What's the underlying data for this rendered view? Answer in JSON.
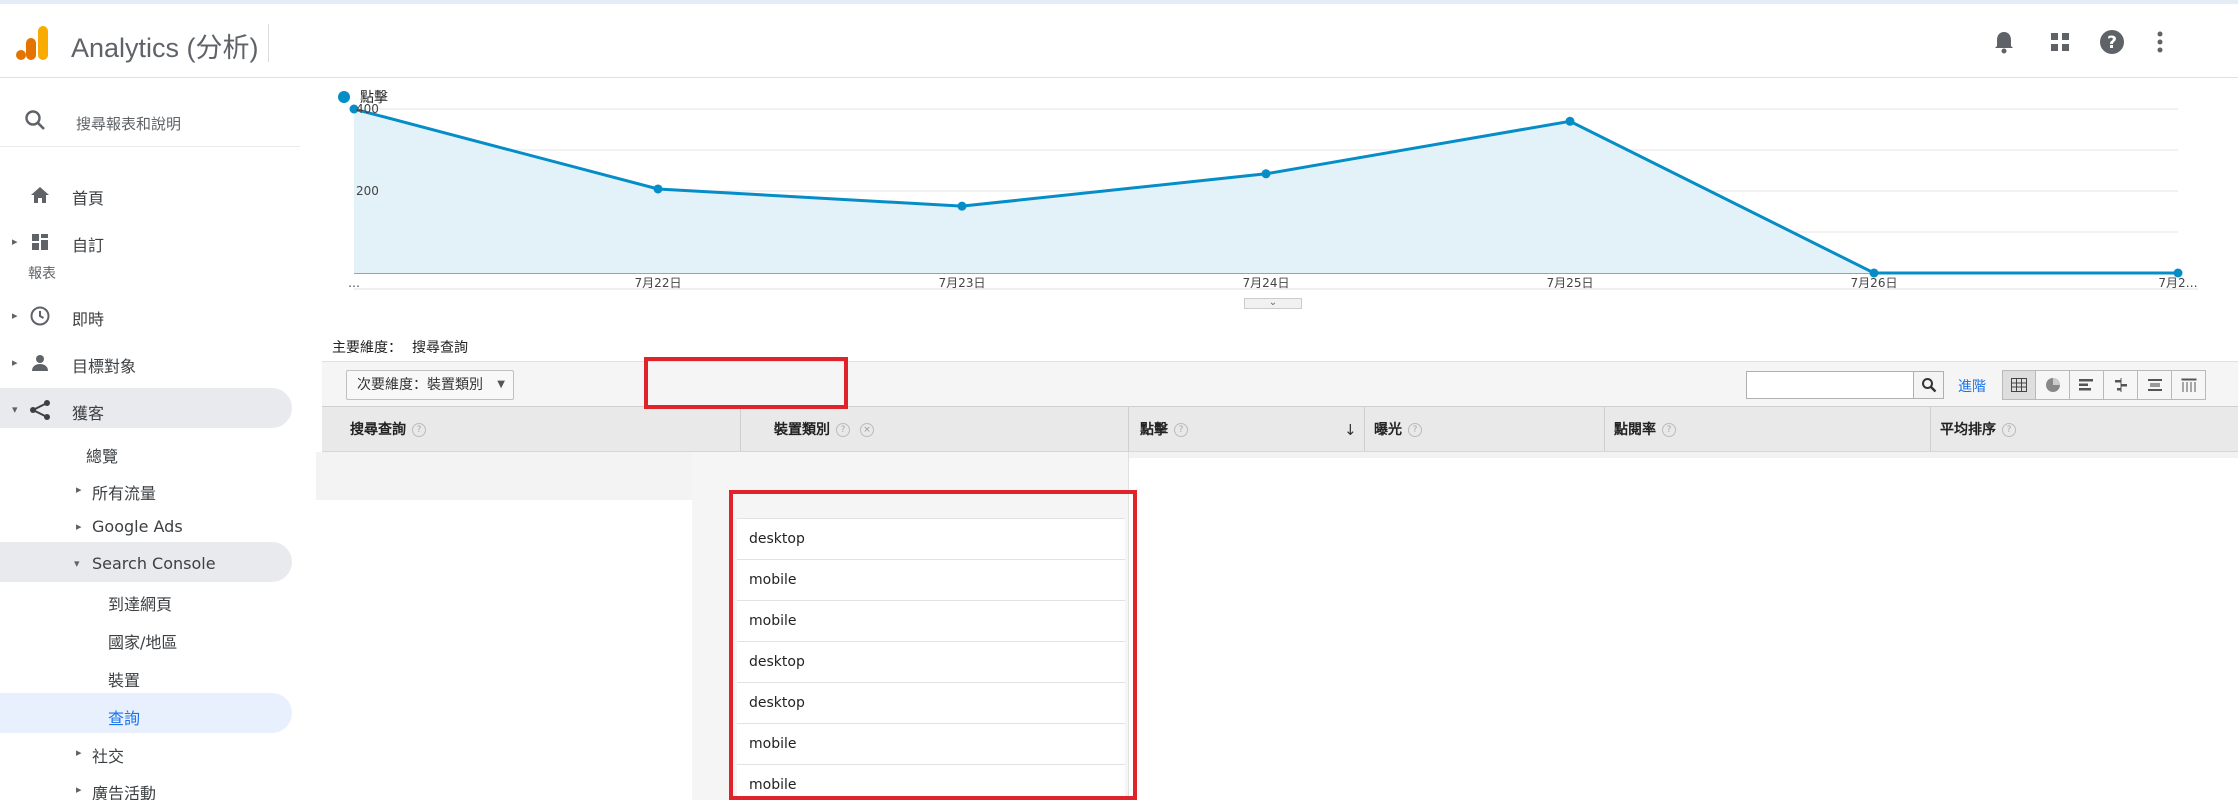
{
  "app": {
    "title": "Analytics (分析)"
  },
  "topbar": {
    "icons": [
      "bell-icon",
      "apps-grid-icon",
      "help-icon",
      "more-vert-icon"
    ]
  },
  "sidebar": {
    "search_label": "搜尋報表和說明",
    "section_reports": "報表",
    "items": [
      {
        "label": "首頁",
        "icon": "home-icon"
      },
      {
        "label": "自訂",
        "icon": "dashboard-icon"
      },
      {
        "label": "即時",
        "icon": "clock-icon"
      },
      {
        "label": "目標對象",
        "icon": "person-icon"
      },
      {
        "label": "獲客",
        "icon": "acquisition-icon"
      },
      {
        "label": "總覽"
      },
      {
        "label": "所有流量"
      },
      {
        "label": "Google Ads"
      },
      {
        "label": "Search Console"
      },
      {
        "label": "到達網頁"
      },
      {
        "label": "國家/地區"
      },
      {
        "label": "裝置"
      },
      {
        "label": "查詢"
      },
      {
        "label": "社交"
      },
      {
        "label": "廣告活動"
      }
    ]
  },
  "chart_data": {
    "type": "area",
    "series": [
      {
        "name": "點擊",
        "values": [
          400,
          205,
          163,
          242,
          370,
          0,
          0
        ]
      }
    ],
    "x": [
      "…",
      "7月22日",
      "7月23日",
      "7月24日",
      "7月25日",
      "7月26日",
      "7月2…"
    ],
    "ylim": [
      0,
      400
    ],
    "yticks": [
      "400",
      "200"
    ],
    "grid": true,
    "legend_position": "top-left",
    "color": "#058dc7",
    "fill": "#e3f1f9"
  },
  "report": {
    "primary_dim_label": "主要維度：",
    "primary_dim_value": "搜尋查詢",
    "secondary_dim_button": "次要維度：裝置類別",
    "search_value": "",
    "advanced_link": "進階",
    "view_buttons": [
      "table-view-icon",
      "pie-view-icon",
      "bar-view-icon",
      "comparison-view-icon",
      "term-cloud-icon",
      "pivot-view-icon"
    ],
    "columns": [
      "搜尋查詢",
      "裝置類別",
      "點擊",
      "曝光",
      "點閱率",
      "平均排序"
    ],
    "device_values": [
      "desktop",
      "mobile",
      "mobile",
      "desktop",
      "desktop",
      "mobile",
      "mobile"
    ]
  },
  "colors": {
    "accent": "#1a73e8",
    "highlight": "#e0232b",
    "logo_orange": "#f9ab00",
    "logo_dark_orange": "#e37400"
  }
}
